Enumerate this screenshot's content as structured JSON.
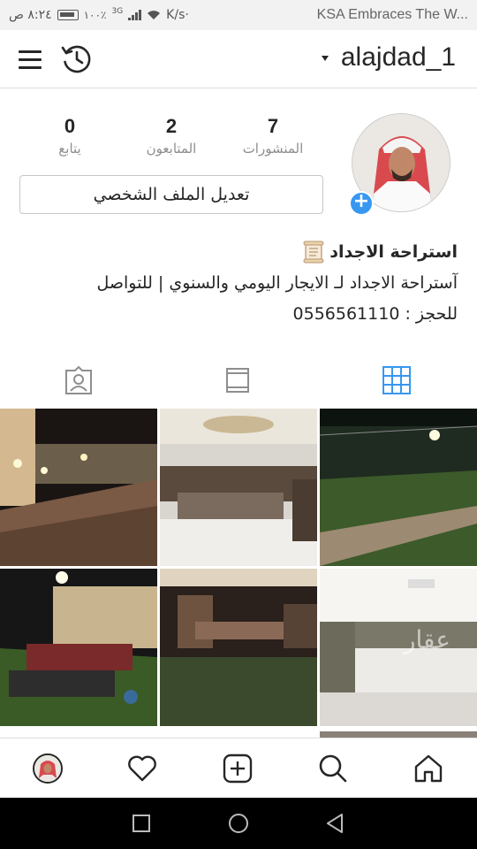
{
  "status_bar": {
    "time": "٨:٢٤ ص",
    "battery": "١٠٠٪",
    "network": "3G",
    "speed": "K/s·",
    "notification": "KSA Embraces The W..."
  },
  "header": {
    "username": "alajdad_1"
  },
  "profile": {
    "stats": {
      "posts_count": "7",
      "posts_label": "المنشورات",
      "followers_count": "2",
      "followers_label": "المتابعون",
      "following_count": "0",
      "following_label": "يتابع"
    },
    "edit_profile_label": "تعديل الملف الشخصي",
    "bio": {
      "name": "استراحة الاجداد",
      "line1": "آستراحة الاجداد لـ الايجار اليومي والسنوي | للتواصل",
      "line2": "للحجز : 0556561110"
    }
  },
  "tabs": [
    {
      "name": "grid-view",
      "active": true
    },
    {
      "name": "feed-view",
      "active": false
    },
    {
      "name": "tagged-view",
      "active": false
    }
  ],
  "grid_posts": [
    {
      "description": "outdoor courtyard at night"
    },
    {
      "description": "majlis hall with floor seating"
    },
    {
      "description": "football field at night"
    },
    {
      "description": "outdoor seating on grass at night"
    },
    {
      "description": "interior hall with carpet"
    },
    {
      "description": "white majlis room"
    }
  ],
  "watermark": "عقار",
  "colors": {
    "accent": "#3897f0",
    "text": "#262626",
    "secondary": "#8e8e8e",
    "border": "#dbdbdb"
  }
}
